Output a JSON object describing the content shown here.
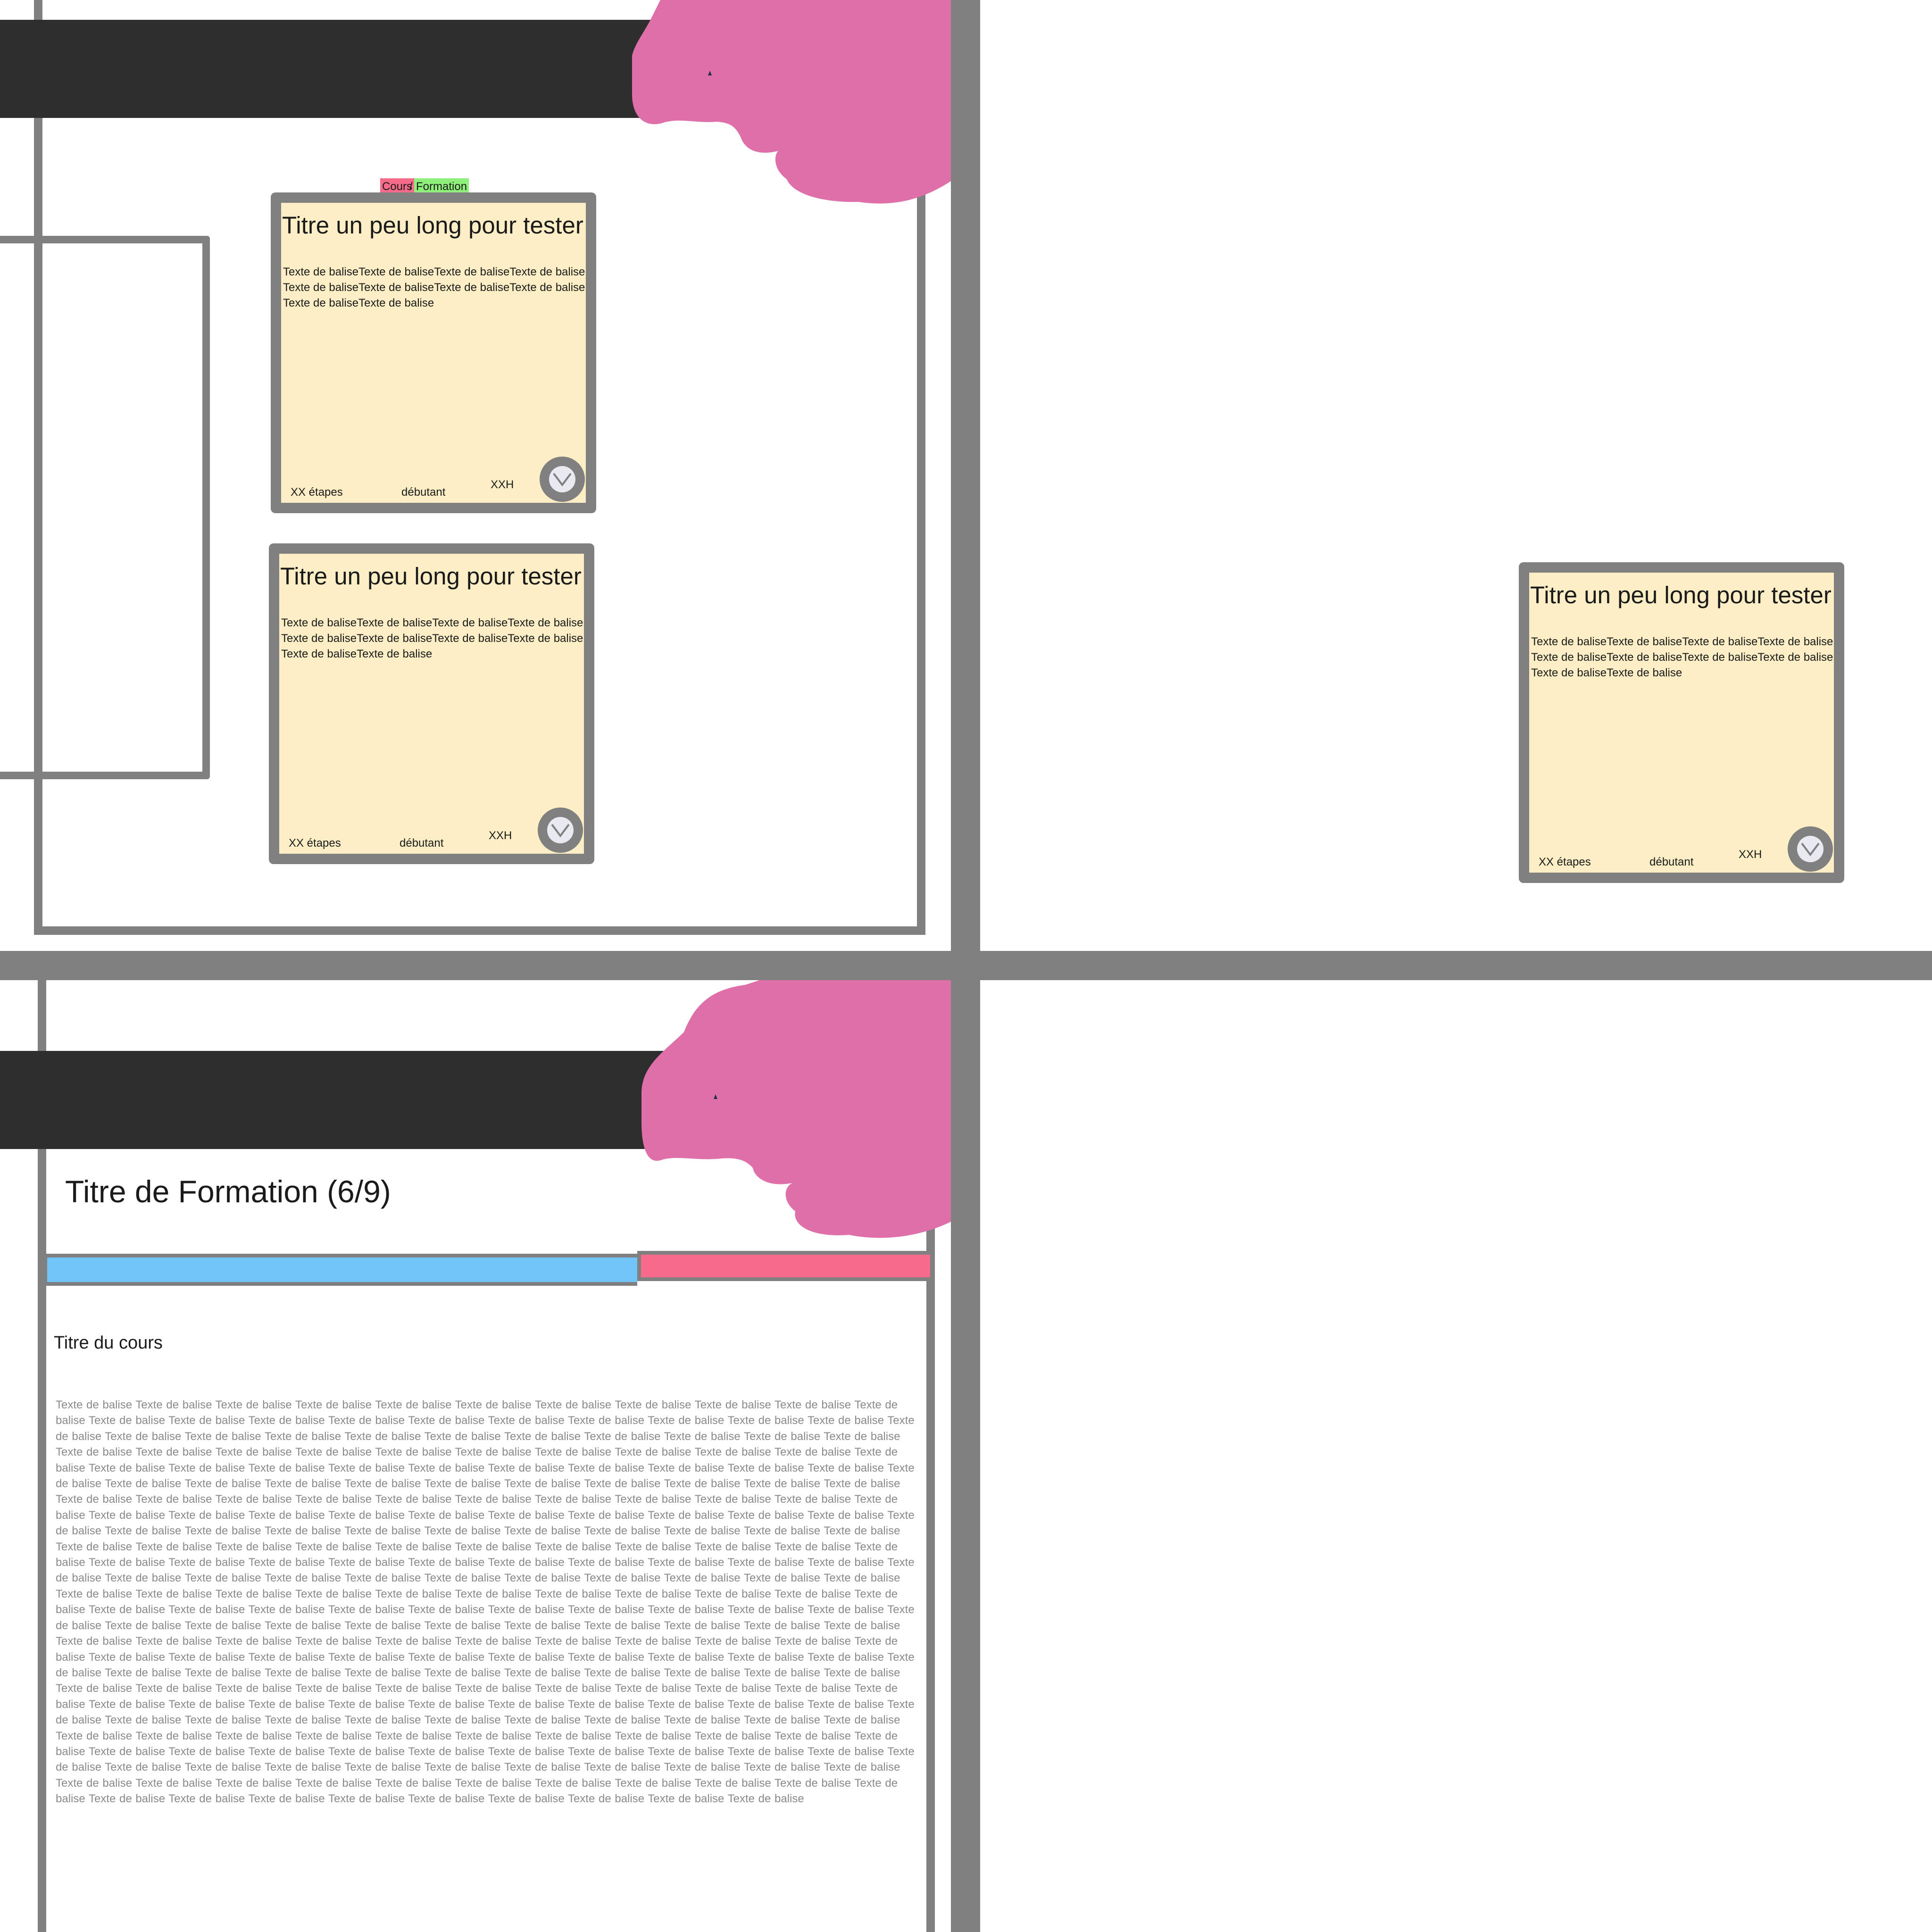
{
  "colors": {
    "separator": "#808080",
    "topbar": "#2e2e2e",
    "blob": "#de6fa8",
    "card_bg": "#fdeec6",
    "tag_cours": "#f66b8a",
    "tag_formation": "#8ef07a",
    "progress_done": "#70c4f8",
    "progress_rest": "#f66b8a"
  },
  "tags": {
    "cours": "Cours",
    "slash": "/",
    "formation": "Formation"
  },
  "card": {
    "title": "Titre un peu long pour tester",
    "text": "Texte de baliseTexte de baliseTexte de baliseTexte de balise Texte de baliseTexte de baliseTexte de baliseTexte de balise Texte de baliseTexte de balise",
    "steps": "XX étapes",
    "level": "débutant",
    "duration": "XXH",
    "action_icon": "chevron-down-icon"
  },
  "detail": {
    "formation_title": "Titre de Formation (6/9)",
    "progress": {
      "completed": 6,
      "total": 9
    },
    "course_title": "Titre du cours",
    "course_body": "Texte de balise Texte de balise Texte de balise Texte de balise Texte de balise Texte de balise Texte de balise Texte de balise Texte de balise Texte de balise Texte de balise Texte de balise Texte de balise Texte de balise Texte de balise Texte de balise Texte de balise Texte de balise Texte de balise Texte de balise Texte de balise Texte de balise Texte de balise Texte de balise Texte de balise Texte de balise Texte de balise Texte de balise Texte de balise Texte de balise Texte de balise Texte de balise Texte de balise Texte de balise Texte de balise Texte de balise Texte de balise Texte de balise Texte de balise Texte de balise Texte de balise Texte de balise Texte de balise Texte de balise Texte de balise Texte de balise Texte de balise Texte de balise Texte de balise Texte de balise Texte de balise Texte de balise Texte de balise Texte de balise Texte de balise Texte de balise Texte de balise Texte de balise Texte de balise Texte de balise Texte de balise Texte de balise Texte de balise Texte de balise Texte de balise Texte de balise Texte de balise Texte de balise Texte de balise Texte de balise Texte de balise Texte de balise Texte de balise Texte de balise Texte de balise Texte de balise Texte de balise Texte de balise Texte de balise Texte de balise Texte de balise Texte de balise Texte de balise Texte de balise Texte de balise Texte de balise Texte de balise Texte de balise Texte de balise Texte de balise Texte de balise Texte de balise Texte de balise Texte de balise Texte de balise Texte de balise Texte de balise Texte de balise Texte de balise Texte de balise Texte de balise Texte de balise Texte de balise Texte de balise Texte de balise Texte de balise Texte de balise Texte de balise Texte de balise Texte de balise Texte de balise Texte de balise Texte de balise Texte de balise Texte de balise Texte de balise Texte de balise Texte de balise Texte de balise Texte de balise Texte de balise Texte de balise Texte de balise Texte de balise Texte de balise Texte de balise Texte de balise Texte de balise Texte de balise Texte de balise Texte de balise Texte de balise Texte de balise Texte de balise Texte de balise Texte de balise Texte de balise Texte de balise Texte de balise Texte de balise Texte de balise Texte de balise Texte de balise Texte de balise Texte de balise Texte de balise Texte de balise Texte de balise Texte de balise Texte de balise Texte de balise Texte de balise Texte de balise Texte de balise Texte de balise Texte de balise Texte de balise Texte de balise Texte de balise Texte de balise Texte de balise Texte de balise Texte de balise Texte de balise Texte de balise Texte de balise Texte de balise Texte de balise Texte de balise Texte de balise Texte de balise Texte de balise Texte de balise Texte de balise Texte de balise Texte de balise Texte de balise Texte de balise Texte de balise Texte de balise Texte de balise Texte de balise Texte de balise Texte de balise Texte de balise Texte de balise Texte de balise Texte de balise Texte de balise Texte de balise Texte de balise Texte de balise Texte de balise Texte de balise Texte de balise Texte de balise Texte de balise Texte de balise Texte de balise Texte de balise Texte de balise Texte de balise Texte de balise Texte de balise Texte de balise Texte de balise Texte de balise Texte de balise Texte de balise Texte de balise Texte de balise Texte de balise Texte de balise Texte de balise Texte de balise Texte de balise Texte de balise Texte de balise Texte de balise Texte de balise Texte de balise Texte de balise Texte de balise Texte de balise Texte de balise Texte de balise Texte de balise Texte de balise Texte de balise Texte de balise Texte de balise Texte de balise Texte de balise Texte de balise Texte de balise Texte de balise Texte de balise Texte de balise Texte de balise Texte de balise Texte de balise Texte de balise Texte de balise Texte de balise Texte de balise Texte de balise Texte de balise Texte de balise Texte de balise Texte de balise Texte de balise Texte de balise Texte de balise Texte de balise Texte de balise Texte de balise Texte de balise Texte de balise Texte de balise Texte de balise Texte de balise Texte de balise Texte de balise Texte de balise Texte de balise Texte de balise Texte de balise Texte de balise Texte de balise Texte de balise Texte de balise Texte de balise Texte de balise Texte de balise Texte de balise Texte de balise"
  }
}
